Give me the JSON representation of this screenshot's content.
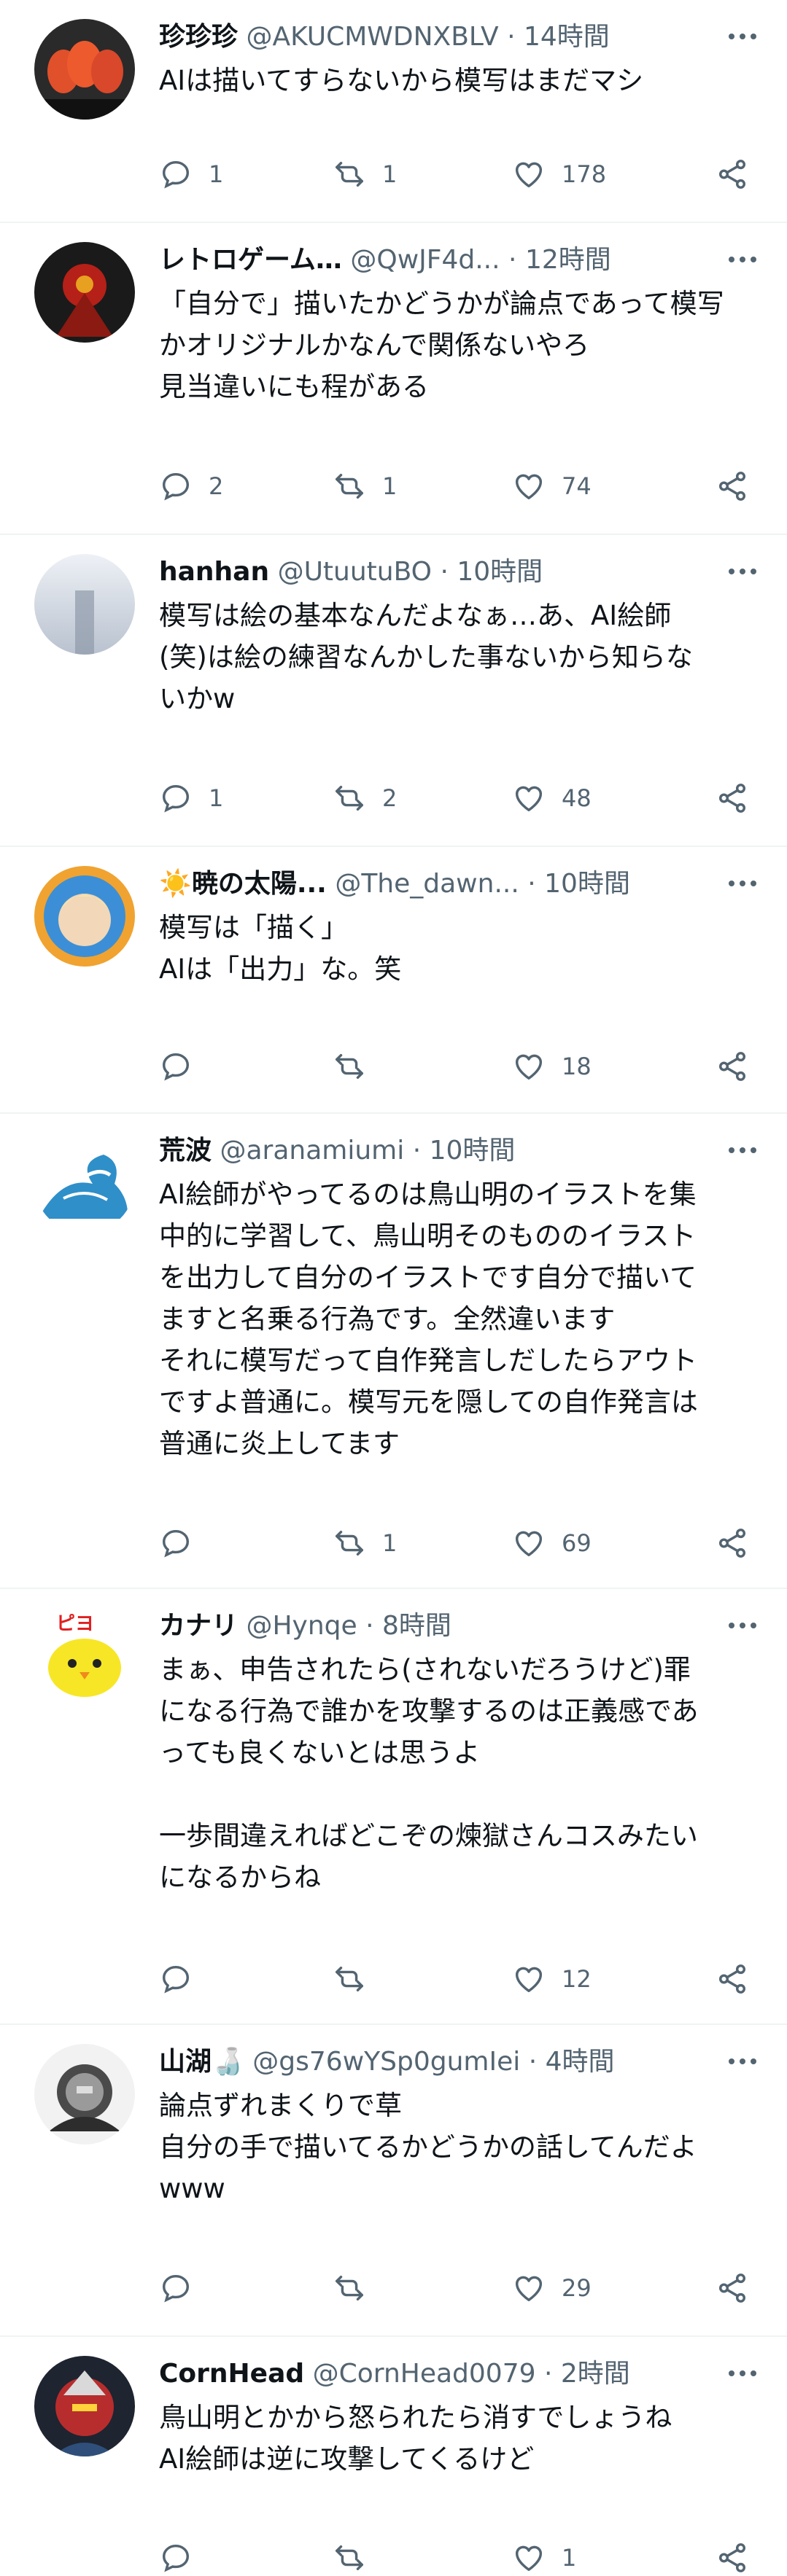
{
  "tweets": [
    {
      "name": "珍珍珍",
      "handle": "@AKUCMWDNXBLV",
      "dot": "·",
      "time": "14時間",
      "text": "AIは描いてすらないから模写はまだマシ",
      "replies": "1",
      "retweets": "1",
      "likes": "178"
    },
    {
      "name": "レトロゲーム…",
      "handle": "@QwJF4d...",
      "dot": "·",
      "time": "12時間",
      "text": "「自分で」描いたかどうかが論点であって模写\nかオリジナルかなんで関係ないやろ\n見当違いにも程がある",
      "replies": "2",
      "retweets": "1",
      "likes": "74"
    },
    {
      "name": "hanhan",
      "handle": "@UtuutuBO",
      "dot": "·",
      "time": "10時間",
      "text": "模写は絵の基本なんだよなぁ…あ、AI絵師\n(笑)は絵の練習なんかした事ないから知らな\nいかw",
      "replies": "1",
      "retweets": "2",
      "likes": "48"
    },
    {
      "name": "☀️暁の太陽...",
      "handle": "@The_dawn...",
      "dot": "·",
      "time": "10時間",
      "text": "模写は「描く」\nAIは「出力」な。笑",
      "replies": "",
      "retweets": "",
      "likes": "18"
    },
    {
      "name": "荒波",
      "handle": "@aranamiumi",
      "dot": "·",
      "time": "10時間",
      "text": "AI絵師がやってるのは鳥山明のイラストを集\n中的に学習して、鳥山明そのもののイラスト\nを出力して自分のイラストです自分で描いて\nますと名乗る行為です。全然違います\nそれに模写だって自作発言しだしたらアウト\nですよ普通に。模写元を隠しての自作発言は\n普通に炎上してます",
      "replies": "",
      "retweets": "1",
      "likes": "69"
    },
    {
      "name": "カナリ",
      "handle": "@Hynqe",
      "dot": "·",
      "time": "8時間",
      "text": "まぁ、申告されたら(されないだろうけど)罪\nになる行為で誰かを攻撃するのは正義感であ\nっても良くないとは思うよ\n\n一歩間違えればどこぞの煉獄さんコスみたい\nになるからね",
      "replies": "",
      "retweets": "",
      "likes": "12"
    },
    {
      "name": "山湖🍶",
      "handle": "@gs76wYSp0gumIei",
      "dot": "·",
      "time": "4時間",
      "text": "論点ずれまくりで草\n自分の手で描いてるかどうかの話してんだよ\nwww",
      "replies": "",
      "retweets": "",
      "likes": "29"
    },
    {
      "name": "CornHead",
      "handle": "@CornHead0079",
      "dot": "·",
      "time": "2時間",
      "text": "鳥山明とかから怒られたら消すでしょうね\nAI絵師は逆に攻撃してくるけど",
      "replies": "",
      "retweets": "",
      "likes": "1"
    }
  ],
  "icons": {
    "reply": "reply-icon",
    "retweet": "retweet-icon",
    "like": "heart-icon",
    "share": "share-icon",
    "more": "more-icon"
  },
  "colors": {
    "text": "#0f1419",
    "secondary": "#536471",
    "divider": "#eff3f4"
  }
}
